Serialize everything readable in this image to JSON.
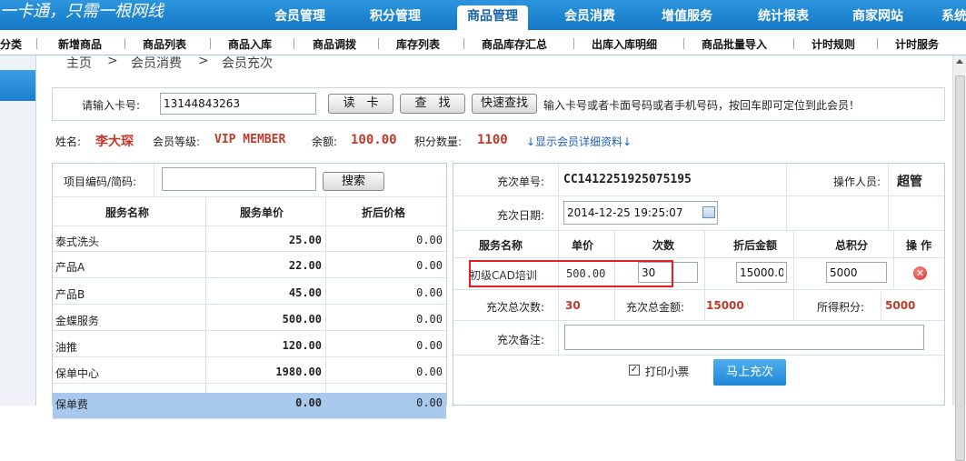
{
  "header": {
    "slogan": "一卡通，只需一根网线",
    "tabs": [
      {
        "label": "会员管理",
        "active": false
      },
      {
        "label": "积分管理",
        "active": false
      },
      {
        "label": "商品管理",
        "active": true
      },
      {
        "label": "会员消费",
        "active": false
      },
      {
        "label": "增值服务",
        "active": false
      },
      {
        "label": "统计报表",
        "active": false
      },
      {
        "label": "商家网站",
        "active": false
      },
      {
        "label": "系统",
        "active": false
      }
    ]
  },
  "subnav": {
    "items": [
      "分类",
      "新增商品",
      "商品列表",
      "商品入库",
      "商品调拨",
      "库存列表",
      "商品库存汇总",
      "出库入库明细",
      "商品批量导入",
      "计时规则",
      "计时服务"
    ]
  },
  "breadcrumb": {
    "home": "主页",
    "sep": ">",
    "level1": "会员消费",
    "level2": "会员充次"
  },
  "card": {
    "label": "请输入卡号:",
    "value": "13144843263",
    "read_btn": "读　卡",
    "find_btn": "查　找",
    "quick_btn": "快速查找",
    "hint": "输入卡号或者卡面号码或者手机号码，按回车即可定位到此会员！"
  },
  "member": {
    "name_label": "姓名:",
    "name": "李大琛",
    "level_label": "会员等级:",
    "level": "VIP MEMBER",
    "balance_label": "余额:",
    "balance": "100.00",
    "points_label": "积分数量:",
    "points": "1100",
    "details_link": "↓显示会员详细资料↓"
  },
  "service_search": {
    "label": "项目编码/简码:",
    "placeholder": "",
    "button": "搜索"
  },
  "service_table": {
    "headers": [
      "服务名称",
      "服务单价",
      "折后价格"
    ],
    "rows": [
      {
        "name": "泰式洗头",
        "price": "25.00",
        "discount": "0.00"
      },
      {
        "name": "产品A",
        "price": "22.00",
        "discount": "0.00"
      },
      {
        "name": "产品B",
        "price": "45.00",
        "discount": "0.00"
      },
      {
        "name": "金蝶服务",
        "price": "500.00",
        "discount": "0.00"
      },
      {
        "name": "油推",
        "price": "120.00",
        "discount": "0.00"
      },
      {
        "name": "保单中心",
        "price": "1980.00",
        "discount": "0.00"
      },
      {
        "name": "保单费",
        "price": "0.00",
        "discount": "0.00"
      }
    ]
  },
  "recharge": {
    "order_label": "充次单号:",
    "order_no": "CC1412251925075195",
    "operator_label": "操作人员:",
    "operator": "超管",
    "date_label": "充次日期:",
    "date": "2014-12-25 19:25:07",
    "item_headers": [
      "服务名称",
      "单价",
      "次数",
      "折后金额",
      "总积分",
      "操 作"
    ],
    "item": {
      "name": "初级CAD培训",
      "price": "500.00",
      "count": "30",
      "amount": "15000.00",
      "points": "5000"
    },
    "total_count_label": "充次总次数:",
    "total_count": "30",
    "total_amount_label": "充次总金额:",
    "total_amount": "15000",
    "earned_points_label": "所得积分:",
    "earned_points": "5000",
    "remark_label": "充次备注:",
    "remark": "",
    "print_label": "打印小票",
    "print_checked": true,
    "submit": "马上充次"
  },
  "colors": {
    "nav": "#1a7fcc",
    "accent_red": "#c0392b",
    "highlight_border": "#e02020",
    "button_blue": "#2a8fd8"
  }
}
